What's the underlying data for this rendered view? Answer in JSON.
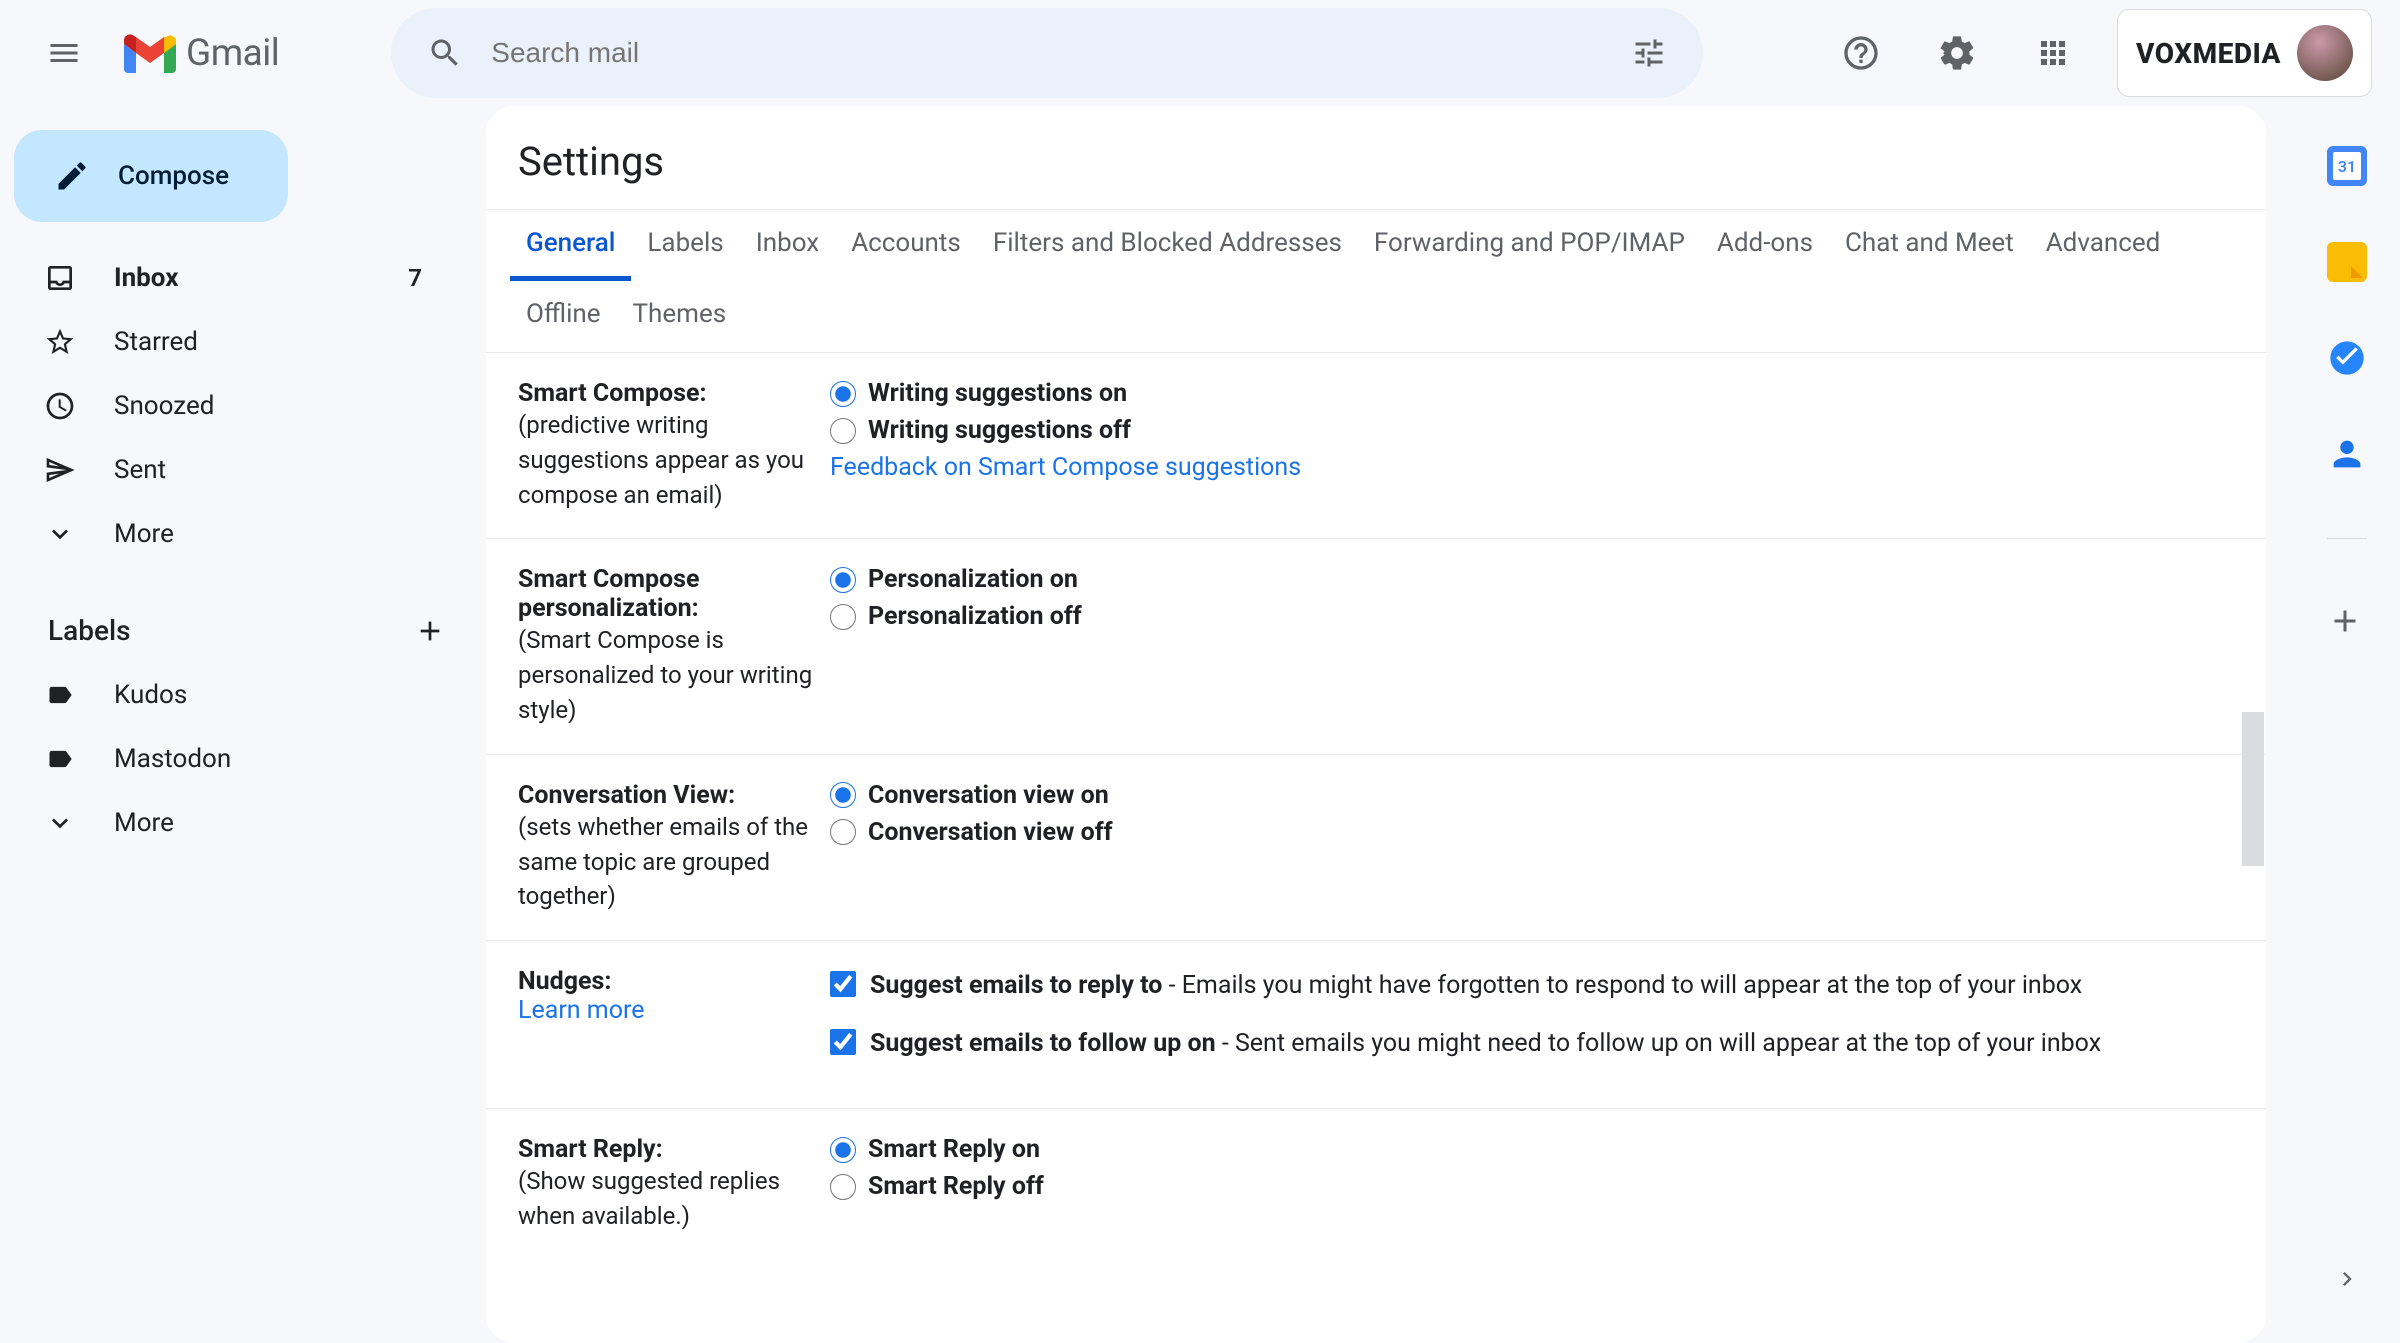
{
  "header": {
    "logo_text": "Gmail",
    "search_placeholder": "Search mail",
    "brand": "VOXMEDIA"
  },
  "sidebar": {
    "compose_label": "Compose",
    "nav": [
      {
        "label": "Inbox",
        "count": "7",
        "icon": "inbox"
      },
      {
        "label": "Starred",
        "count": "",
        "icon": "star"
      },
      {
        "label": "Snoozed",
        "count": "",
        "icon": "clock"
      },
      {
        "label": "Sent",
        "count": "",
        "icon": "send"
      },
      {
        "label": "More",
        "count": "",
        "icon": "expand"
      }
    ],
    "labels_title": "Labels",
    "labels": [
      {
        "label": "Kudos"
      },
      {
        "label": "Mastodon"
      },
      {
        "label": "More"
      }
    ]
  },
  "settings": {
    "title": "Settings",
    "tabs": [
      "General",
      "Labels",
      "Inbox",
      "Accounts",
      "Filters and Blocked Addresses",
      "Forwarding and POP/IMAP",
      "Add-ons",
      "Chat and Meet",
      "Advanced",
      "Offline",
      "Themes"
    ],
    "active_tab": "General",
    "rows": {
      "smart_compose": {
        "name": "Smart Compose:",
        "sub": "(predictive writing suggestions appear as you compose an email)",
        "opt_on": "Writing suggestions on",
        "opt_off": "Writing suggestions off",
        "feedback": "Feedback on Smart Compose suggestions"
      },
      "personalization": {
        "name": "Smart Compose personalization:",
        "sub": "(Smart Compose is personalized to your writing style)",
        "opt_on": "Personalization on",
        "opt_off": "Personalization off"
      },
      "conversation": {
        "name": "Conversation View:",
        "sub": "(sets whether emails of the same topic are grouped together)",
        "opt_on": "Conversation view on",
        "opt_off": "Conversation view off"
      },
      "nudges": {
        "name": "Nudges:",
        "learn": "Learn more",
        "reply_b": "Suggest emails to reply to",
        "reply_t": " - Emails you might have forgotten to respond to will appear at the top of your inbox",
        "follow_b": "Suggest emails to follow up on",
        "follow_t": " - Sent emails you might need to follow up on will appear at the top of your inbox"
      },
      "smart_reply": {
        "name": "Smart Reply:",
        "sub": "(Show suggested replies when available.)",
        "opt_on": "Smart Reply on",
        "opt_off": "Smart Reply off"
      }
    }
  }
}
